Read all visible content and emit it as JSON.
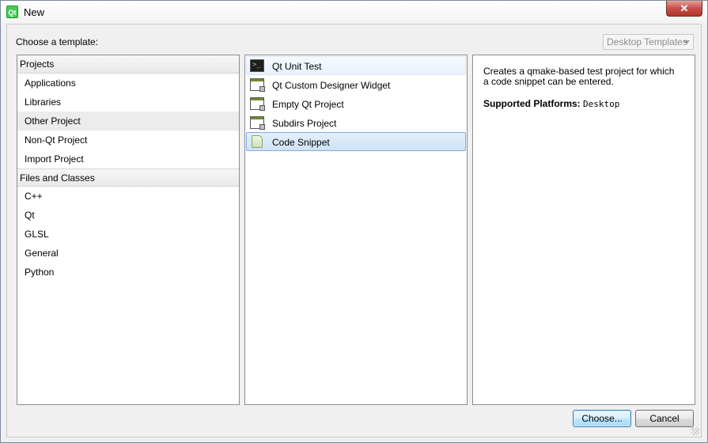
{
  "window": {
    "title": "New",
    "app_icon_glyph": "Qt",
    "close_glyph": "✕"
  },
  "dialog": {
    "choose_label": "Choose a template:",
    "filter": {
      "selected": "Desktop Templates"
    }
  },
  "categories": {
    "groups": [
      {
        "header": "Projects",
        "items": [
          {
            "label": "Applications"
          },
          {
            "label": "Libraries"
          },
          {
            "label": "Other Project",
            "selected": true
          },
          {
            "label": "Non-Qt Project"
          },
          {
            "label": "Import Project"
          }
        ]
      },
      {
        "header": "Files and Classes",
        "items": [
          {
            "label": "C++"
          },
          {
            "label": "Qt"
          },
          {
            "label": "GLSL"
          },
          {
            "label": "General"
          },
          {
            "label": "Python"
          }
        ]
      }
    ]
  },
  "templates": {
    "items": [
      {
        "label": "Qt Unit Test",
        "icon": "terminal-icon"
      },
      {
        "label": "Qt Custom Designer Widget",
        "icon": "window-icon"
      },
      {
        "label": "Empty Qt Project",
        "icon": "window-icon"
      },
      {
        "label": "Subdirs Project",
        "icon": "window-icon"
      },
      {
        "label": "Code Snippet",
        "icon": "document-icon",
        "selected": true
      }
    ]
  },
  "description": {
    "text": "Creates a qmake-based test project for which a code snippet can be entered.",
    "platforms_label": "Supported Platforms:",
    "platforms_value": "Desktop"
  },
  "buttons": {
    "choose": "Choose...",
    "cancel": "Cancel"
  },
  "colors": {
    "selection_border": "#84acdd",
    "close_button": "#c75050",
    "qt_green": "#41cd52"
  }
}
